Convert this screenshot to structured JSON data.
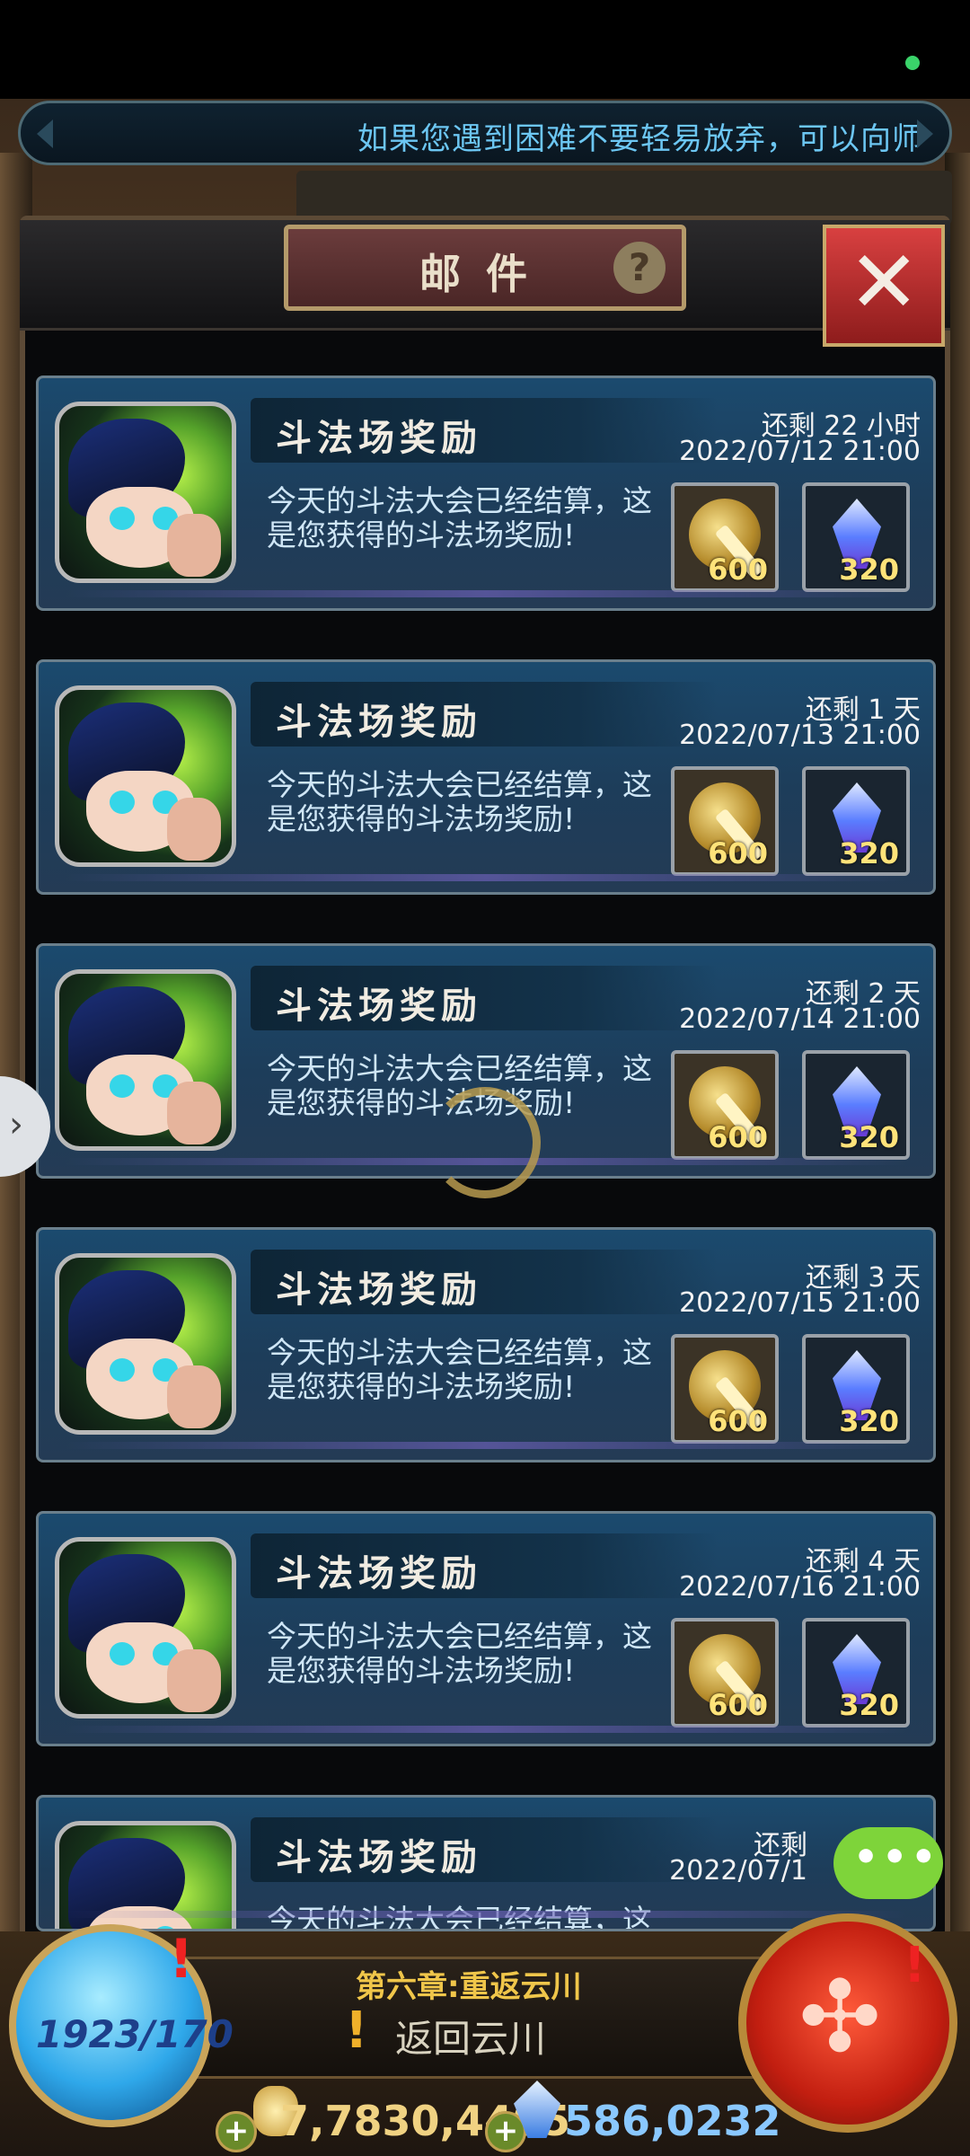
{
  "ticker": {
    "text": "如果您遇到困难不要轻易放弃，可以向师"
  },
  "panel": {
    "title": "邮件",
    "help_label": "?",
    "close_label": "✕"
  },
  "mails": [
    {
      "title": "斗法场奖励",
      "remaining": "还剩 22 小时",
      "date": "2022/07/12 21:00",
      "body": "今天的斗法大会已经结算，这是您获得的斗法场奖励!",
      "reward1": "600",
      "reward2": "320"
    },
    {
      "title": "斗法场奖励",
      "remaining": "还剩 1 天",
      "date": "2022/07/13 21:00",
      "body": "今天的斗法大会已经结算，这是您获得的斗法场奖励!",
      "reward1": "600",
      "reward2": "320"
    },
    {
      "title": "斗法场奖励",
      "remaining": "还剩 2 天",
      "date": "2022/07/14 21:00",
      "body": "今天的斗法大会已经结算，这是您获得的斗法场奖励!",
      "reward1": "600",
      "reward2": "320"
    },
    {
      "title": "斗法场奖励",
      "remaining": "还剩 3 天",
      "date": "2022/07/15 21:00",
      "body": "今天的斗法大会已经结算，这是您获得的斗法场奖励!",
      "reward1": "600",
      "reward2": "320"
    },
    {
      "title": "斗法场奖励",
      "remaining": "还剩 4 天",
      "date": "2022/07/16 21:00",
      "body": "今天的斗法大会已经结算，这是您获得的斗法场奖励!",
      "reward1": "600",
      "reward2": "320"
    },
    {
      "title": "斗法场奖励",
      "remaining": "还剩",
      "date": "2022/07/1",
      "body": "今天的斗法大会已经结算，这",
      "reward1": "",
      "reward2": ""
    }
  ],
  "hud": {
    "chapter": "第六章:重返云川",
    "return_label": "返回云川",
    "energy": "1923/170",
    "gold": "7,7830,4495",
    "gems": "586,0232",
    "plus": "+"
  },
  "icons": {
    "reward1": "sword-icon",
    "reward2": "crystal-icon",
    "chat": "chat-bubble-icon"
  }
}
